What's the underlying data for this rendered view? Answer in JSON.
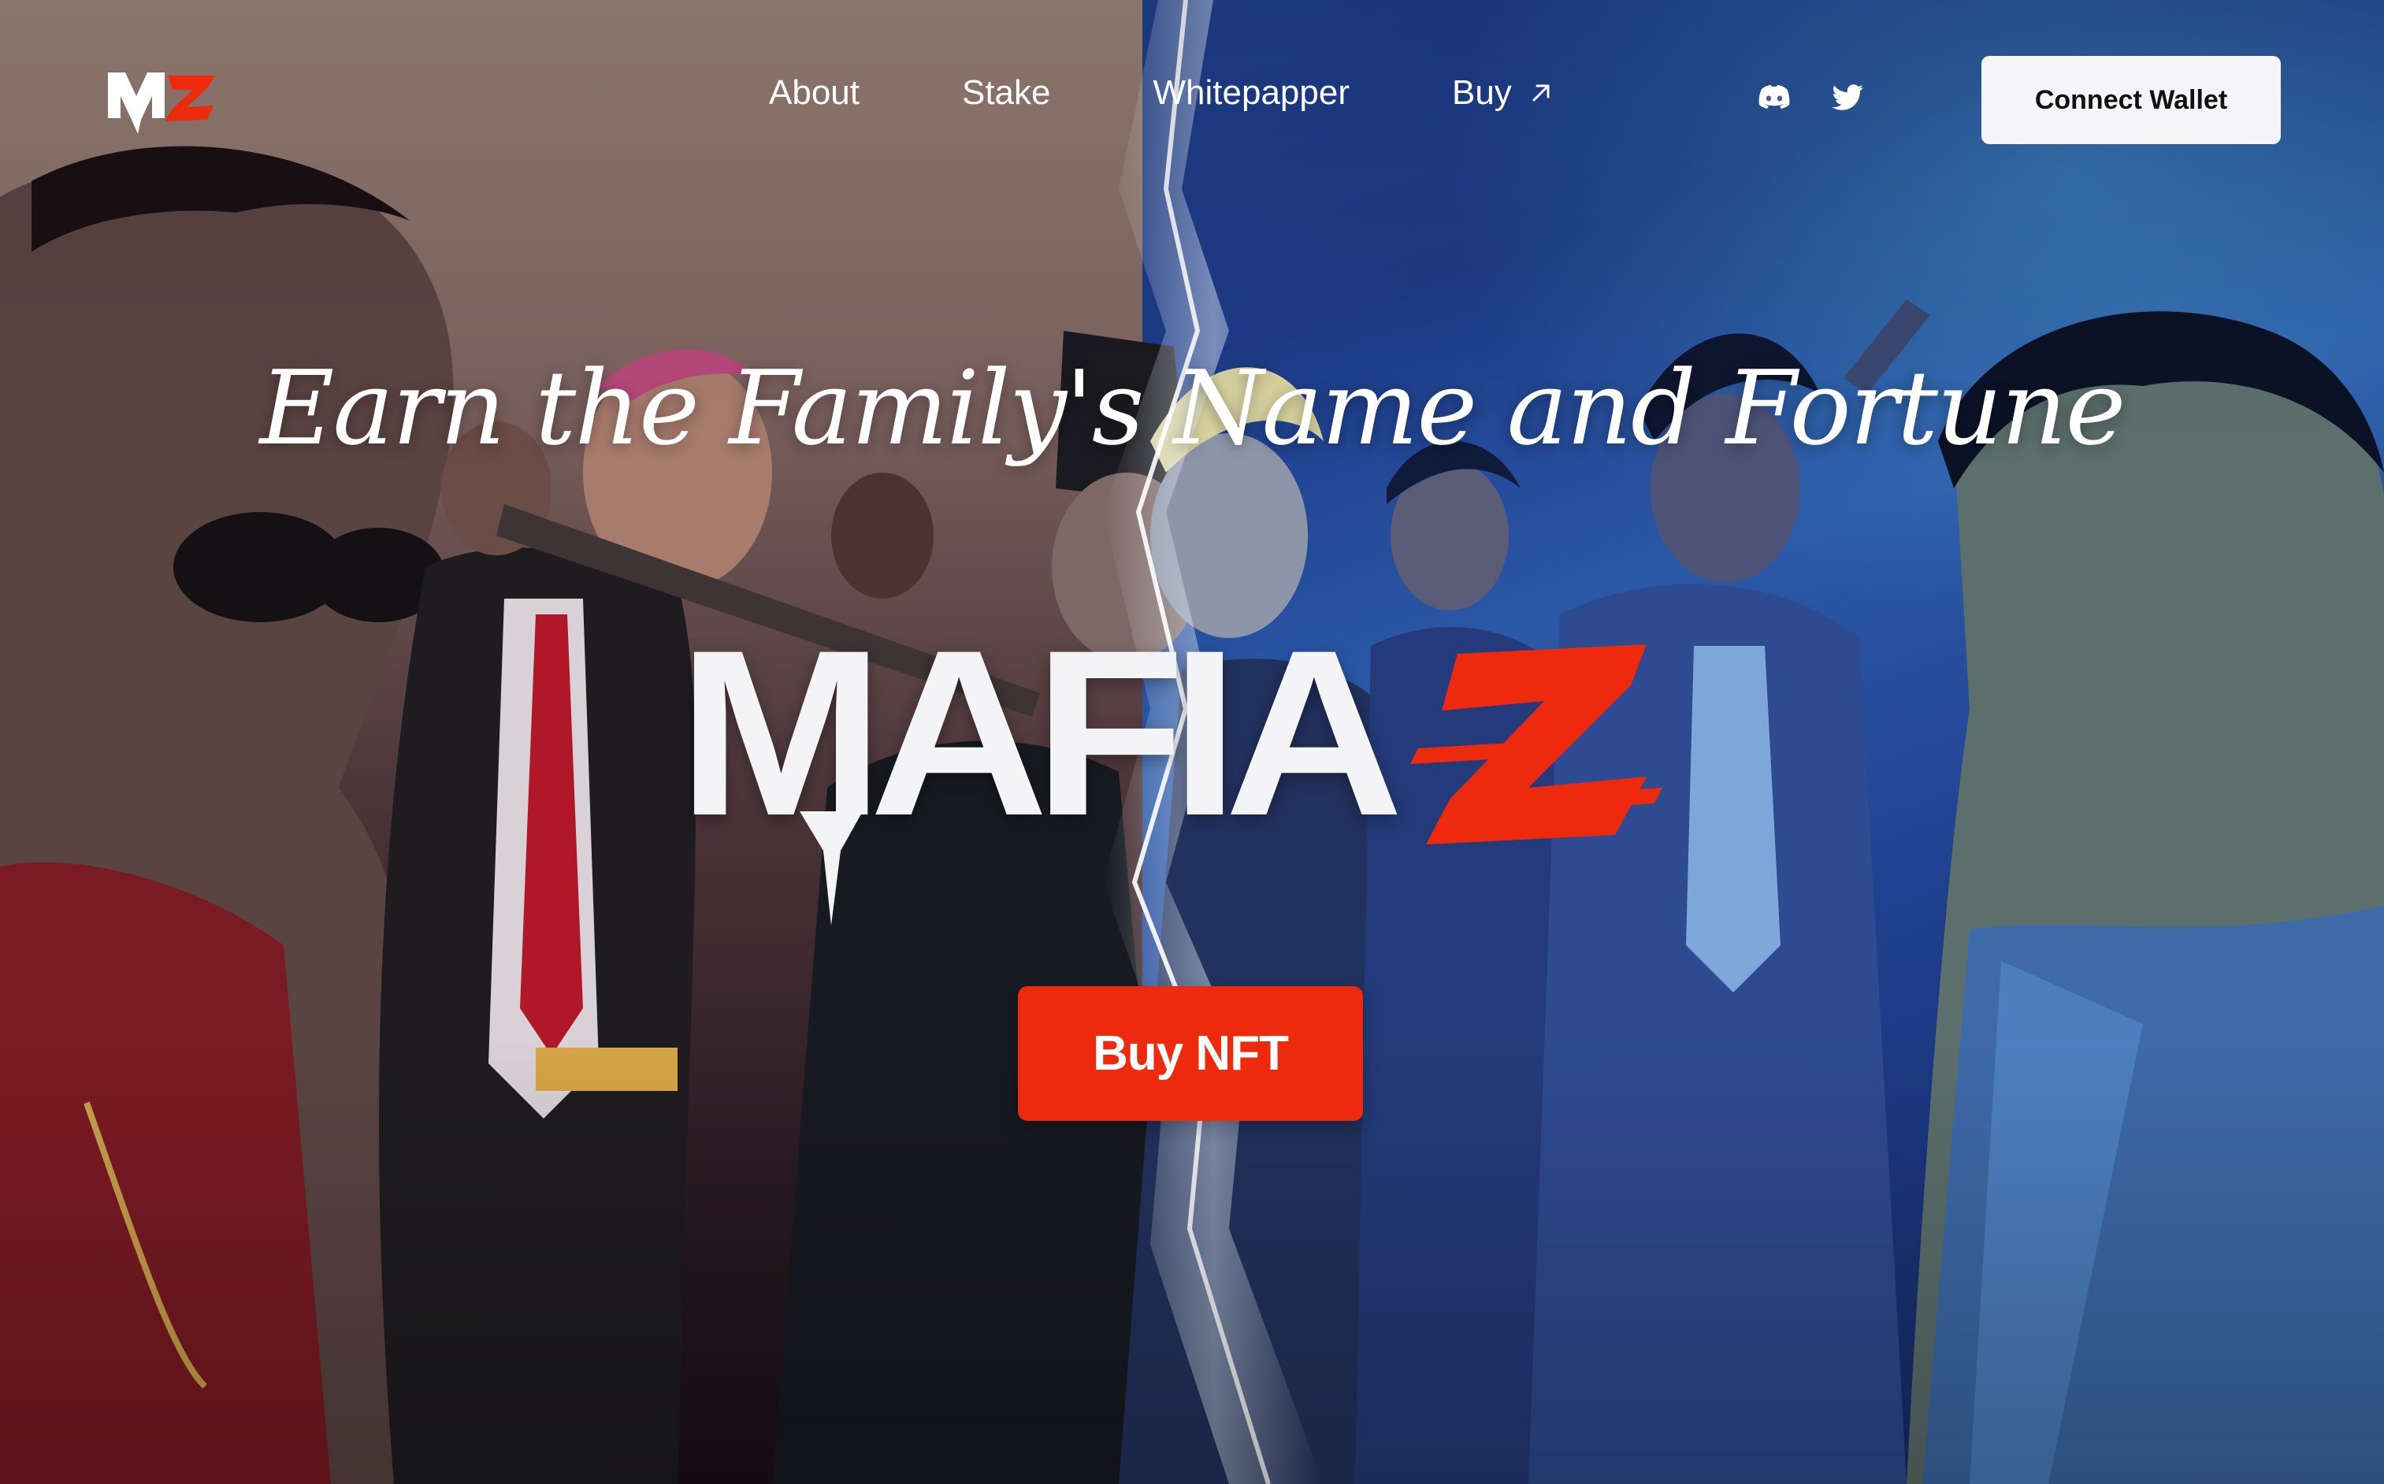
{
  "nav": {
    "logo_icon": "mz-logo-icon",
    "links": [
      {
        "label": "About"
      },
      {
        "label": "Stake"
      },
      {
        "label": "Whitepapper"
      },
      {
        "label": "Buy",
        "icon": "arrow-up-right-icon"
      }
    ],
    "social": [
      {
        "icon": "discord-icon"
      },
      {
        "icon": "twitter-icon"
      }
    ],
    "connect_label": "Connect Wallet"
  },
  "hero": {
    "tagline": "Earn the Family's Name and Fortune",
    "brand": "MAFIA",
    "brand_z": "Z",
    "background_image": "hero-mafia-illustration",
    "cta_label": "Buy NFT"
  },
  "colors": {
    "accent_red": "#ee2a0e",
    "text_white": "#ffffff",
    "button_light": "#f5f5f7",
    "left_tone": "#7d635f",
    "right_tone": "#1d3a87"
  }
}
